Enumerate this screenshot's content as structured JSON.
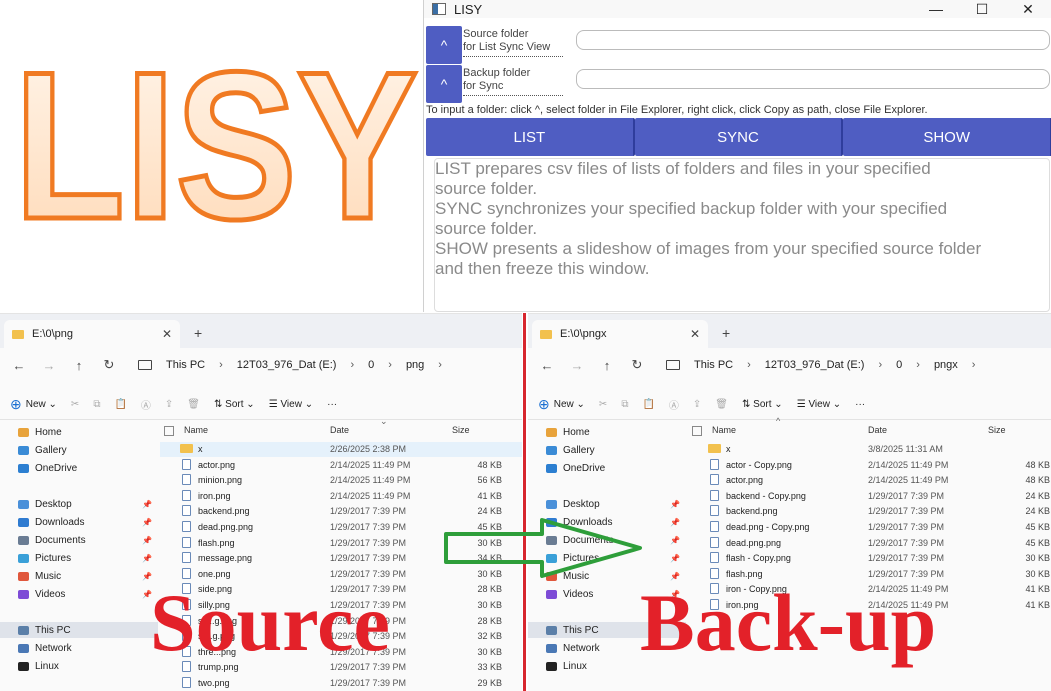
{
  "logo": {
    "text": "LISY"
  },
  "lisy_window": {
    "title": "LISY",
    "controls": {
      "minimize": "—",
      "maximize": "☐",
      "close": "✕"
    },
    "source_row": {
      "button": "^",
      "label_line1": "Source folder",
      "label_line2": "for List Sync View",
      "value": ""
    },
    "backup_row": {
      "button": "^",
      "label_line1": "Backup folder",
      "label_line2": "for Sync",
      "value": ""
    },
    "hint": "To input a folder: click ^, select folder in File Explorer, right click, click Copy as path, close File Explorer.",
    "buttons": {
      "list": "LIST",
      "sync": "SYNC",
      "show": "SHOW"
    },
    "description": [
      "LIST prepares csv files of lists of folders and files in your specified",
      "source folder.",
      "SYNC synchronizes your specified backup folder with your specified",
      "source folder.",
      "SHOW presents a slideshow of images from your specified source folder",
      "and then freeze this window."
    ]
  },
  "explorer_left": {
    "tab_title": "E:\\0\\png",
    "new_tab": "+",
    "breadcrumb": [
      "This PC",
      "12T03_976_Dat (E:)",
      "0",
      "png"
    ],
    "toolbar": {
      "new": "New",
      "sort": "Sort",
      "view": "View",
      "more": "···"
    },
    "sidebar": [
      "Home",
      "Gallery",
      "OneDrive",
      "Desktop",
      "Downloads",
      "Documents",
      "Pictures",
      "Music",
      "Videos",
      "This PC",
      "Network",
      "Linux"
    ],
    "columns": {
      "name": "Name",
      "date": "Date",
      "size": "Size"
    },
    "rows": [
      {
        "name": "x",
        "date": "2/26/2025 2:38 PM",
        "size": ""
      },
      {
        "name": "actor.png",
        "date": "2/14/2025 11:49 PM",
        "size": "48 KB"
      },
      {
        "name": "minion.png",
        "date": "2/14/2025 11:49 PM",
        "size": "56 KB"
      },
      {
        "name": "iron.png",
        "date": "2/14/2025 11:49 PM",
        "size": "41 KB"
      },
      {
        "name": "backend.png",
        "date": "1/29/2017 7:39 PM",
        "size": "24 KB"
      },
      {
        "name": "dead.png.png",
        "date": "1/29/2017 7:39 PM",
        "size": "45 KB"
      },
      {
        "name": "flash.png",
        "date": "1/29/2017 7:39 PM",
        "size": "30 KB"
      },
      {
        "name": "message.png",
        "date": "1/29/2017 7:39 PM",
        "size": "34 KB"
      },
      {
        "name": "one.png",
        "date": "1/29/2017 7:39 PM",
        "size": "30 KB"
      },
      {
        "name": "side.png",
        "date": "1/29/2017 7:39 PM",
        "size": "28 KB"
      },
      {
        "name": "silly.png",
        "date": "1/29/2017 7:39 PM",
        "size": "30 KB"
      },
      {
        "name": "sit...g.png",
        "date": "1/29/2017 7:39 PM",
        "size": "28 KB"
      },
      {
        "name": "st...g.png",
        "date": "1/29/2017 7:39 PM",
        "size": "32 KB"
      },
      {
        "name": "thre...png",
        "date": "1/29/2017 7:39 PM",
        "size": "30 KB"
      },
      {
        "name": "trump.png",
        "date": "1/29/2017 7:39 PM",
        "size": "33 KB"
      },
      {
        "name": "two.png",
        "date": "1/29/2017 7:39 PM",
        "size": "29 KB"
      }
    ]
  },
  "explorer_right": {
    "tab_title": "E:\\0\\pngx",
    "new_tab": "+",
    "breadcrumb": [
      "This PC",
      "12T03_976_Dat (E:)",
      "0",
      "pngx"
    ],
    "toolbar": {
      "new": "New",
      "sort": "Sort",
      "view": "View",
      "more": "···"
    },
    "sidebar": [
      "Home",
      "Gallery",
      "OneDrive",
      "Desktop",
      "Downloads",
      "Documents",
      "Pictures",
      "Music",
      "Videos",
      "This PC",
      "Network",
      "Linux"
    ],
    "columns": {
      "name": "Name",
      "date": "Date",
      "size": "Size"
    },
    "rows": [
      {
        "name": "x",
        "date": "3/8/2025 11:31 AM",
        "size": ""
      },
      {
        "name": "actor - Copy.png",
        "date": "2/14/2025 11:49 PM",
        "size": "48 KB"
      },
      {
        "name": "actor.png",
        "date": "2/14/2025 11:49 PM",
        "size": "48 KB"
      },
      {
        "name": "backend - Copy.png",
        "date": "1/29/2017 7:39 PM",
        "size": "24 KB"
      },
      {
        "name": "backend.png",
        "date": "1/29/2017 7:39 PM",
        "size": "24 KB"
      },
      {
        "name": "dead.png - Copy.png",
        "date": "1/29/2017 7:39 PM",
        "size": "45 KB"
      },
      {
        "name": "dead.png.png",
        "date": "1/29/2017 7:39 PM",
        "size": "45 KB"
      },
      {
        "name": "flash - Copy.png",
        "date": "1/29/2017 7:39 PM",
        "size": "30 KB"
      },
      {
        "name": "flash.png",
        "date": "1/29/2017 7:39 PM",
        "size": "30 KB"
      },
      {
        "name": "iron - Copy.png",
        "date": "2/14/2025 11:49 PM",
        "size": "41 KB"
      },
      {
        "name": "iron.png",
        "date": "2/14/2025 11:49 PM",
        "size": "41 KB"
      }
    ]
  },
  "overlay": {
    "source_label": "Source",
    "backup_label": "Back-up",
    "accent_red": "#e32129",
    "arrow_green": "#2e9e3a"
  }
}
